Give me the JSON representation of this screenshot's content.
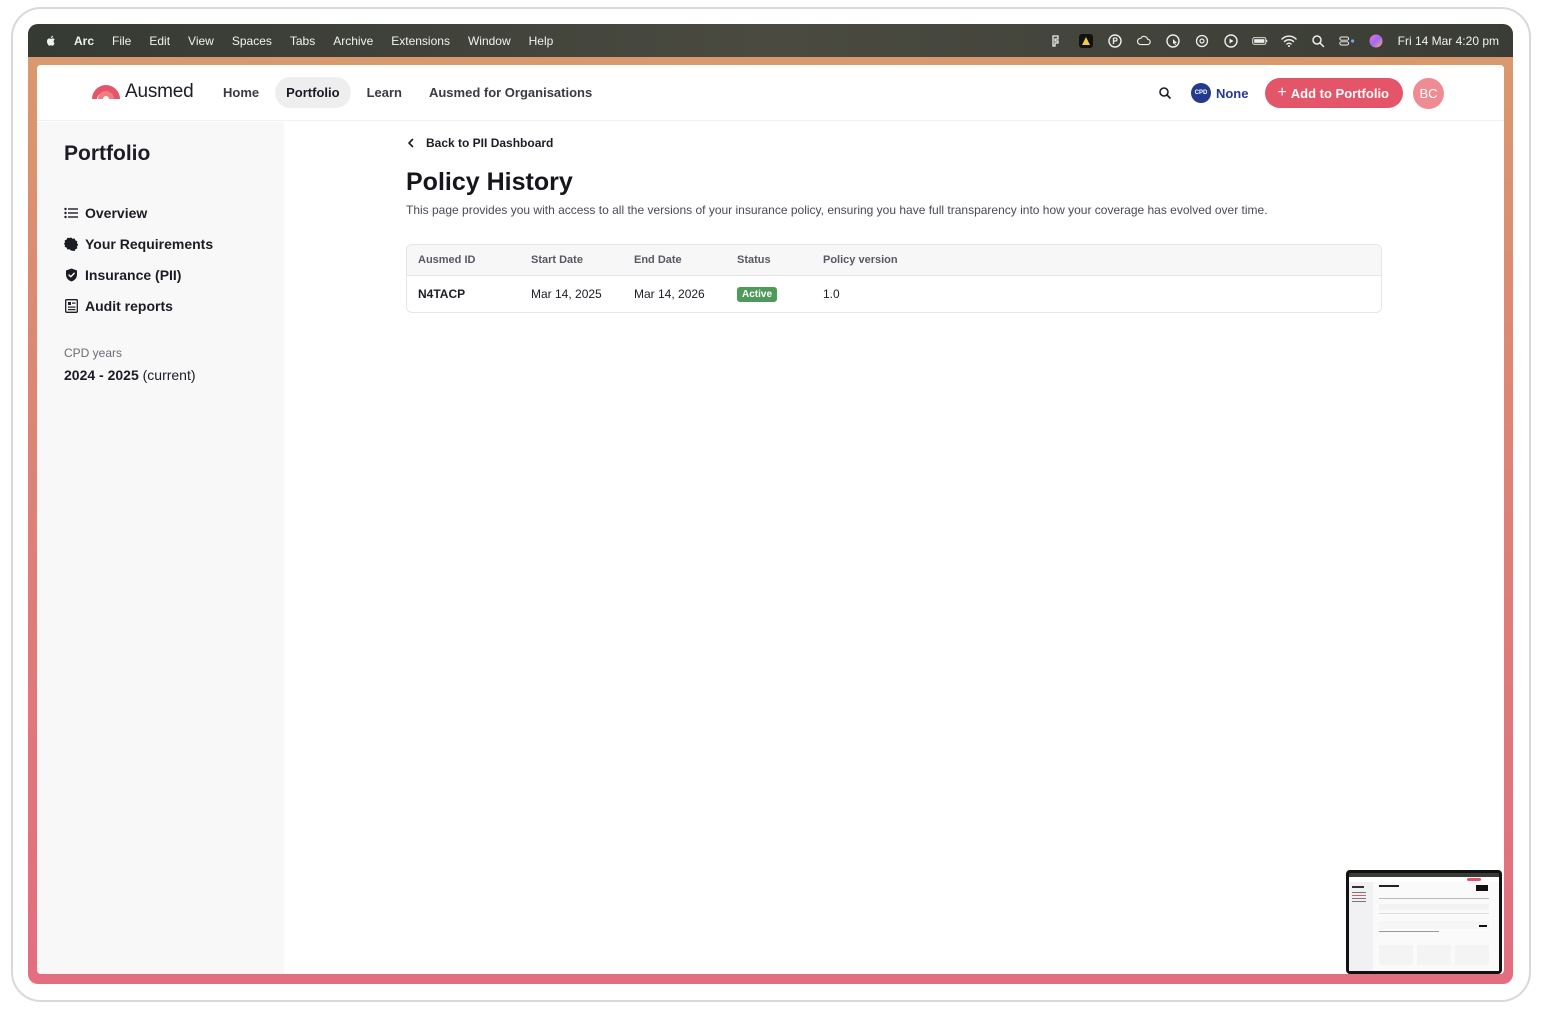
{
  "menubar": {
    "app": "Arc",
    "items": [
      "File",
      "Edit",
      "View",
      "Spaces",
      "Tabs",
      "Archive",
      "Extensions",
      "Window",
      "Help"
    ],
    "clock": "Fri 14 Mar  4:20 pm"
  },
  "nav": {
    "brand": "Ausmed",
    "links": [
      "Home",
      "Portfolio",
      "Learn",
      "Ausmed for Organisations"
    ],
    "cpd_badge": "CPD",
    "cpd_label": "None",
    "add_button": "Add to Portfolio",
    "avatar": "BC"
  },
  "sidebar": {
    "title": "Portfolio",
    "items": [
      "Overview",
      "Your Requirements",
      "Insurance (PII)",
      "Audit reports"
    ],
    "cpd_years_label": "CPD years",
    "cpd_year_range": "2024 - 2025",
    "cpd_year_note": " (current)"
  },
  "main": {
    "back_link": "Back to PII Dashboard",
    "title": "Policy History",
    "description": "This page provides you with access to all the versions of your insurance policy, ensuring you have full transparency into how your coverage has evolved over time.",
    "table": {
      "headers": [
        "Ausmed ID",
        "Start Date",
        "End Date",
        "Status",
        "Policy version"
      ],
      "rows": [
        {
          "id": "N4TACP",
          "start": "Mar 14, 2025",
          "end": "Mar 14, 2026",
          "status": "Active",
          "version": "1.0"
        }
      ]
    }
  },
  "colors": {
    "accent": "#e5556a",
    "cpd_blue": "#233a8f",
    "status_active": "#4f9a5a"
  }
}
